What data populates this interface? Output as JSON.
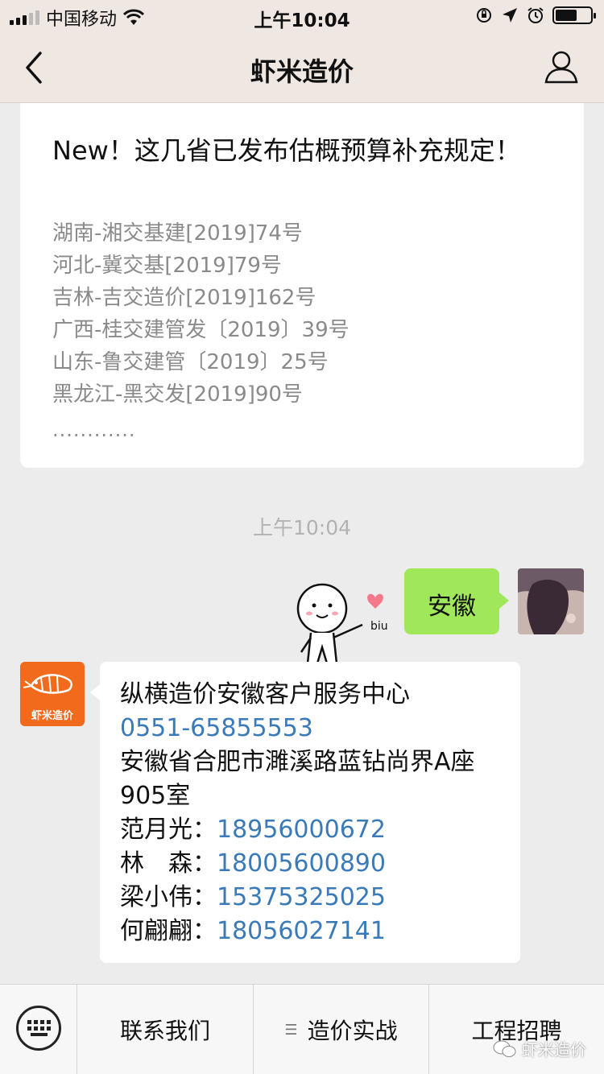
{
  "status_bar": {
    "carrier": "中国移动",
    "time": "上午10:04"
  },
  "nav": {
    "title": "虾米造价"
  },
  "article": {
    "title": "New！这几省已发布估概预算补充规定！",
    "lines": [
      "湖南-湘交基建[2019]74号",
      "河北-冀交基[2019]79号",
      "吉林-吉交造价[2019]162号",
      "广西-桂交建管发〔2019〕39号",
      "山东-鲁交建管〔2019〕25号",
      "黑龙江-黑交发[2019]90号"
    ],
    "ellipsis": "............"
  },
  "chat": {
    "time_separator": "上午10:04",
    "user_message": "安徽",
    "bot_avatar_label": "虾米造价",
    "bot_message": {
      "title": "纵横造价安徽客户服务中心",
      "phone": "0551-65855553",
      "address": "安徽省合肥市濉溪路蓝钻尚界A座905室",
      "contacts": [
        {
          "name": "范月光：",
          "phone": "18956000672"
        },
        {
          "name": "林　森：",
          "phone": "18005600890"
        },
        {
          "name": "梁小伟：",
          "phone": "15375325025"
        },
        {
          "name": "何翩翩：",
          "phone": "18056027141"
        }
      ]
    }
  },
  "menu": {
    "items": [
      "联系我们",
      "造价实战",
      "工程招聘"
    ],
    "watermark": "虾米造价"
  },
  "colors": {
    "user_bubble": "#a0e75a",
    "link": "#3a7ab8",
    "bot_avatar": "#f26b1d"
  }
}
